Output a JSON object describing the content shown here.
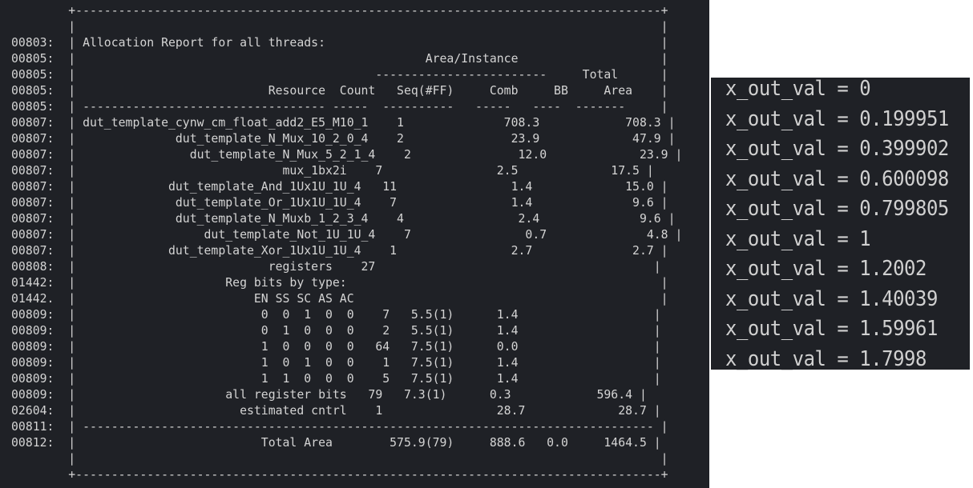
{
  "left_panel": {
    "lines": [
      "        +----------------------------------------------------------------------------------+",
      "        |                                                                                  |",
      "00803:  | Allocation Report for all threads:                                               |",
      "00805:  |                                                 Area/Instance                    |",
      "00805:  |                                          ------------------------     Total      |",
      "00805:  |                           Resource  Count   Seq(#FF)     Comb     BB     Area    |",
      "00805:  | ---------------------------------- -----  ----------   -----   ----  -------     |",
      "00807:  | dut_template_cynw_cm_float_add2_E5_M10_1    1              708.3            708.3 |",
      "00807:  |              dut_template_N_Mux_10_2_0_4    2               23.9             47.9 |",
      "00807:  |                dut_template_N_Mux_5_2_1_4    2               12.0             23.9 |",
      "00807:  |                             mux_1bx2i    7                2.5             17.5 |",
      "00807:  |             dut_template_And_1Ux1U_1U_4   11                1.4             15.0 |",
      "00807:  |              dut_template_Or_1Ux1U_1U_4    7                1.4              9.6 |",
      "00807:  |              dut_template_N_Muxb_1_2_3_4    4                2.4              9.6 |",
      "00807:  |                  dut_template_Not_1U_1U_4    7                0.7              4.8 |",
      "00807:  |             dut_template_Xor_1Ux1U_1U_4    1                2.7              2.7 |",
      "00808:  |                           registers    27                                       |",
      "01442:  |                     Reg bits by type:                                            |",
      "01442.  |                         EN SS SC AS AC                                           |",
      "00809:  |                          0  0  1  0  0    7   5.5(1)      1.4                   |",
      "00809:  |                          0  1  0  0  0    2   5.5(1)      1.4                   |",
      "00809:  |                          1  0  0  0  0   64   7.5(1)      0.0                   |",
      "00809:  |                          1  0  1  0  0    1   7.5(1)      1.4                   |",
      "00809:  |                          1  1  0  0  0    5   7.5(1)      1.4                   |",
      "00809:  |                     all register bits   79   7.3(1)      0.3            596.4 |",
      "02604:  |                       estimated cntrl    1                28.7             28.7 |",
      "00811:  | -------------------------------------------------------------------------------- |",
      "00812:  |                          Total Area        575.9(79)     888.6   0.0     1464.5 |",
      "        |                                                                                  |",
      "        +----------------------------------------------------------------------------------+"
    ]
  },
  "right_panel": {
    "values": [
      "x_out_val = 0",
      "x_out_val = 0.199951",
      "x_out_val = 0.399902",
      "x_out_val = 0.600098",
      "x_out_val = 0.799805",
      "x_out_val = 1",
      "x_out_val = 1.2002",
      "x_out_val = 1.40039",
      "x_out_val = 1.59961",
      "x_out_val = 1.7998"
    ]
  }
}
